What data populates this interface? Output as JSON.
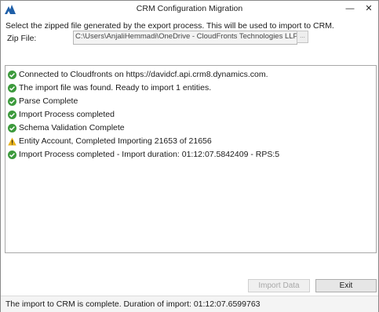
{
  "window": {
    "title": "CRM Configuration Migration",
    "minimize_glyph": "—",
    "close_glyph": "✕"
  },
  "instruction": "Select the zipped file generated by the export process. This will be used to import to CRM.",
  "zip": {
    "label": "Zip File:",
    "value": "C:\\Users\\AnjaliHemmadi\\OneDrive - CloudFronts Technologies LLP\\Notebooks\\Sel",
    "browse_label": "..."
  },
  "log": [
    {
      "status": "success",
      "icon": "check-circle-icon",
      "text": "Connected to Cloudfronts on https://davidcf.api.crm8.dynamics.com."
    },
    {
      "status": "success",
      "icon": "check-circle-icon",
      "text": "The import file was found. Ready to import 1 entities."
    },
    {
      "status": "success",
      "icon": "check-circle-icon",
      "text": "Parse Complete"
    },
    {
      "status": "success",
      "icon": "check-circle-icon",
      "text": "Import Process completed"
    },
    {
      "status": "success",
      "icon": "check-circle-icon",
      "text": "Schema Validation Complete"
    },
    {
      "status": "warning",
      "icon": "warning-triangle-icon",
      "text": "Entity Account, Completed Importing 21653 of 21656"
    },
    {
      "status": "success",
      "icon": "check-circle-icon",
      "text": "Import Process completed - Import duration: 01:12:07.5842409 - RPS:5"
    }
  ],
  "buttons": {
    "import_label": "Import Data",
    "exit_label": "Exit"
  },
  "status_bar": {
    "text": "The import to CRM is complete. Duration of import: 01:12:07.6599763"
  },
  "colors": {
    "success": "#3c9a3c",
    "warning": "#e8b21a",
    "app_icon": "#1f5fa8"
  }
}
